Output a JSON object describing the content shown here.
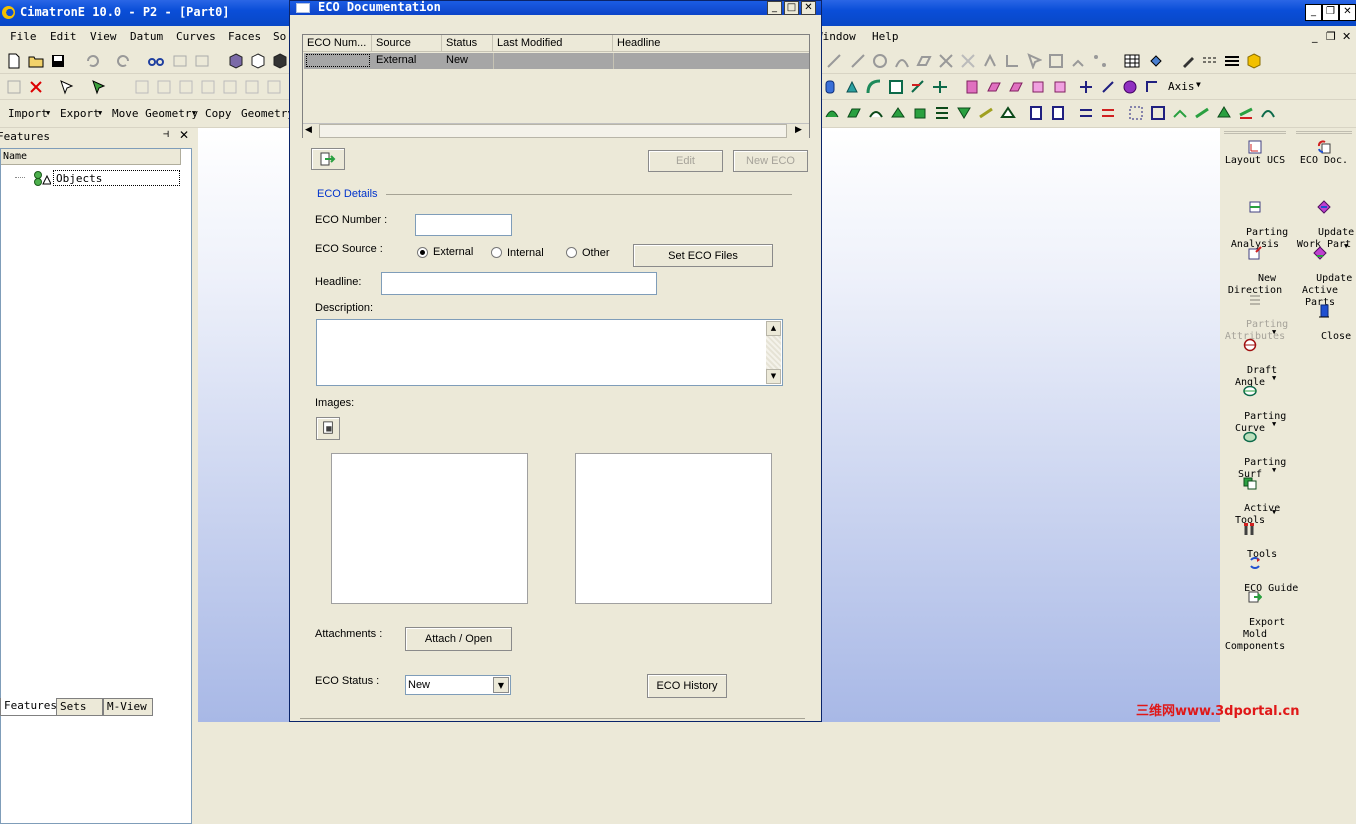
{
  "window": {
    "title": "CimatronE 10.0 - P2 - [Part0]",
    "controls": {
      "minimize": "_",
      "restore": "❐",
      "close": "✕"
    }
  },
  "menu": {
    "items": [
      "File",
      "Edit",
      "View",
      "Datum",
      "Curves",
      "Faces",
      "So"
    ],
    "right_items": [
      "Window",
      "Help"
    ],
    "mdi": {
      "minimize": "_",
      "restore": "❐",
      "close": "✕"
    }
  },
  "toolbar3": {
    "items": [
      "Import",
      "Export",
      "Move Geometry",
      "Copy",
      "Geometry"
    ],
    "axis_label": "Axis"
  },
  "features_panel": {
    "title": "Features",
    "column": "Name",
    "tree_root": "Objects",
    "tabs": [
      "Features",
      "Sets",
      "M-View"
    ]
  },
  "right_palette_1": [
    {
      "label": "Layout UCS",
      "icon": "layout-ucs-icon",
      "disabled": false
    },
    {
      "label": "Parting\nAnalysis",
      "icon": "parting-analysis-icon",
      "disabled": false
    },
    {
      "label": "New\nDirection",
      "icon": "new-direction-icon",
      "disabled": false
    },
    {
      "label": "Parting\nAttributes",
      "icon": "parting-attributes-icon",
      "disabled": true
    },
    {
      "label": "Draft\nAngle",
      "icon": "draft-angle-icon",
      "disabled": false
    },
    {
      "label": "Parting\nCurve",
      "icon": "parting-curve-icon",
      "disabled": false
    },
    {
      "label": "Parting\nSurf",
      "icon": "parting-surf-icon",
      "disabled": false
    },
    {
      "label": "Active\nTools",
      "icon": "active-tools-icon",
      "disabled": false
    },
    {
      "label": "Tools",
      "icon": "tools-icon",
      "disabled": false
    },
    {
      "label": "ECO Guide",
      "icon": "eco-guide-icon",
      "disabled": false
    },
    {
      "label": "Export\nMold\nComponents",
      "icon": "export-mold-icon",
      "disabled": false
    }
  ],
  "right_palette_2": [
    {
      "label": "ECO Doc.",
      "icon": "eco-doc-icon"
    },
    {
      "label": "Update\nWork Part",
      "icon": "update-work-part-icon"
    },
    {
      "label": "Update\nActive\nParts",
      "icon": "update-active-parts-icon"
    },
    {
      "label": "Close",
      "icon": "close-door-icon"
    }
  ],
  "dialog": {
    "title": "ECO Documentation",
    "controls": {
      "minimize": "_",
      "maximize": "□",
      "close": "✕"
    },
    "table": {
      "columns": [
        "ECO Num...",
        "Source",
        "Status",
        "Last Modified",
        "Headline"
      ],
      "rows": [
        [
          "",
          "External",
          "New",
          "",
          ""
        ]
      ]
    },
    "buttons": {
      "edit": "Edit",
      "new_eco": "New ECO",
      "set_eco_files": "Set ECO Files",
      "attach_open": "Attach / Open",
      "eco_history": "ECO History"
    },
    "section_title": "ECO Details",
    "labels": {
      "eco_number": "ECO Number :",
      "eco_source": "ECO Source :",
      "headline": "Headline:",
      "description": "Description:",
      "images": "Images:",
      "attachments": "Attachments :",
      "eco_status": "ECO Status :"
    },
    "source_options": [
      "External",
      "Internal",
      "Other"
    ],
    "selected_source": "External",
    "values": {
      "eco_number": "",
      "headline": "",
      "description": ""
    },
    "status_value": "New"
  },
  "watermark": "三维网www.3dportal.cn"
}
